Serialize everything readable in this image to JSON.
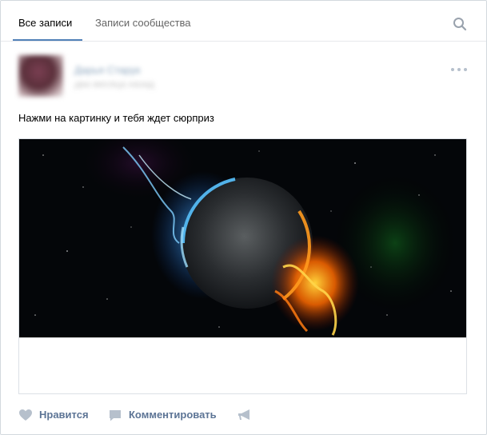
{
  "tabs": {
    "all_posts": "Все записи",
    "community_posts": "Записи сообщества"
  },
  "post": {
    "author_name": "Дарья Старук",
    "date": "два месяца назад",
    "text": "Нажми на картинку и тебя ждет сюрприз",
    "image_description_icon": "planet-fire-ice-image"
  },
  "actions": {
    "like": "Нравится",
    "comment": "Комментировать",
    "share_icon": "megaphone-icon"
  },
  "colors": {
    "accent": "#5181b8",
    "action_text": "#5c7495",
    "icon": "#b6c0cc"
  }
}
